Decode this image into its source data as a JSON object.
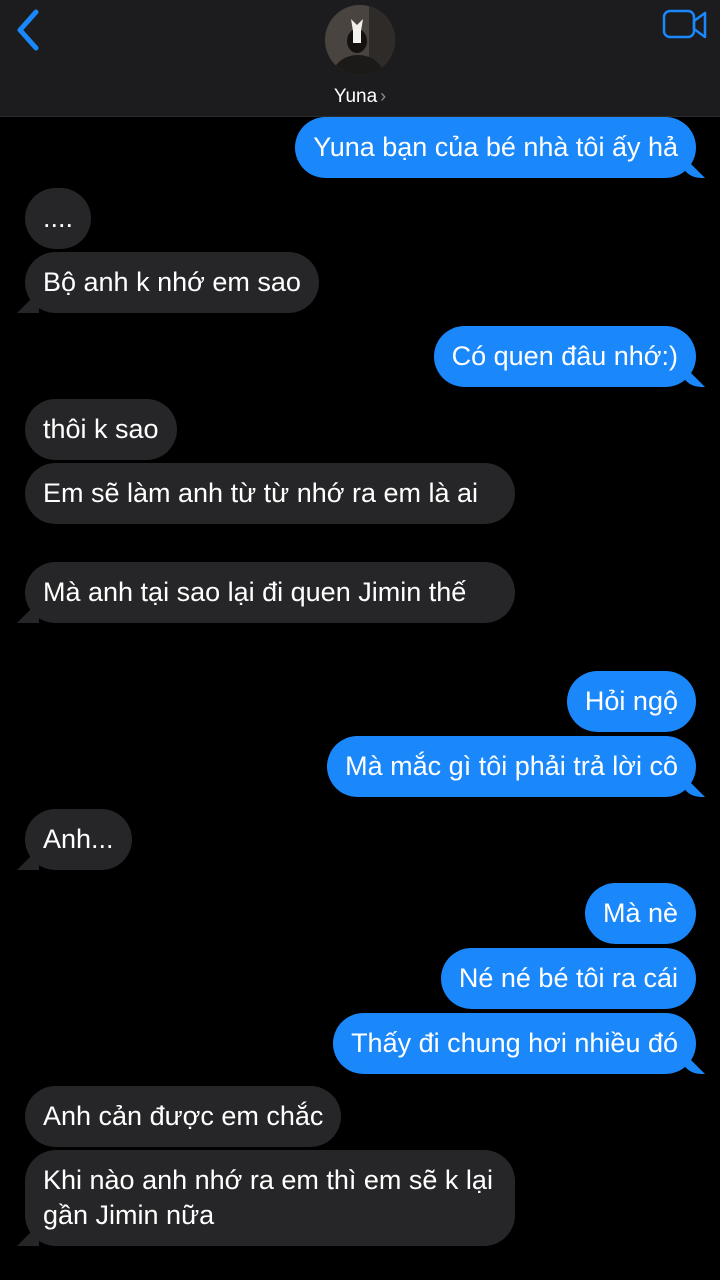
{
  "header": {
    "contact_name": "Yuna",
    "back_icon": "chevron-left-icon",
    "video_icon": "video-camera-icon",
    "accent_color": "#1a88fb"
  },
  "messages": [
    {
      "from": "me",
      "text": "Yuna bạn của bé nhà tôi ấy hả"
    },
    {
      "from": "them",
      "text": "...."
    },
    {
      "from": "them",
      "text": "Bộ anh k nhớ em sao"
    },
    {
      "from": "me",
      "text": "Có quen đâu nhớ:)"
    },
    {
      "from": "them",
      "text": "thôi k sao"
    },
    {
      "from": "them",
      "text": "Em sẽ làm anh từ từ nhớ ra em là ai"
    },
    {
      "from": "them",
      "text": "Mà anh tại sao lại đi quen Jimin thế"
    },
    {
      "from": "me",
      "text": "Hỏi ngộ"
    },
    {
      "from": "me",
      "text": "Mà mắc gì tôi phải trả lời cô"
    },
    {
      "from": "them",
      "text": "Anh..."
    },
    {
      "from": "me",
      "text": "Mà nè"
    },
    {
      "from": "me",
      "text": "Né né bé tôi ra cái"
    },
    {
      "from": "me",
      "text": "Thấy đi chung hơi nhiều đó"
    },
    {
      "from": "them",
      "text": "Anh cản được em chắc"
    },
    {
      "from": "them",
      "text": "Khi nào anh nhớ ra em thì em sẽ k lại gần Jimin nữa"
    }
  ]
}
